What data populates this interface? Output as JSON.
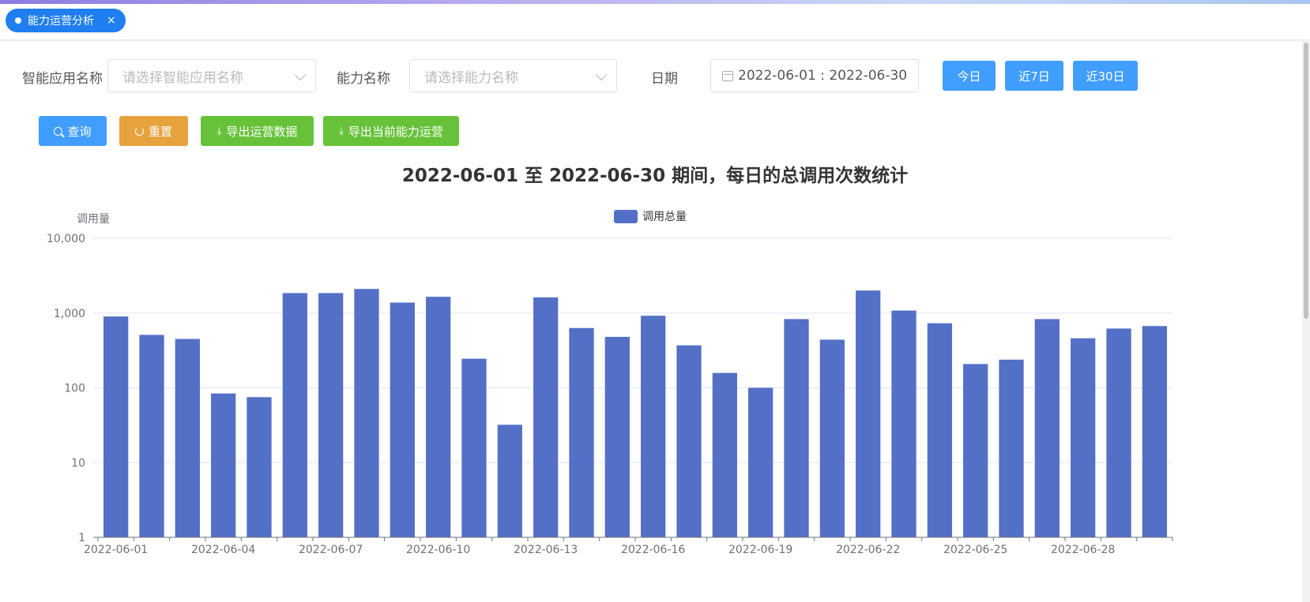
{
  "tab": {
    "label": "能力运营分析",
    "close": "×"
  },
  "filters": {
    "app_label": "智能应用名称",
    "app_placeholder": "请选择智能应用名称",
    "ability_label": "能力名称",
    "ability_placeholder": "请选择能力名称",
    "date_label": "日期",
    "date_value": "2022-06-01 : 2022-06-30"
  },
  "quick": {
    "today": "今日",
    "last7": "近7日",
    "last30": "近30日"
  },
  "actions": {
    "query": "查询",
    "reset": "重置",
    "export_ops": "导出运营数据",
    "export_current": "导出当前能力运营"
  },
  "chart_data": {
    "type": "bar",
    "title": "2022-06-01 至 2022-06-30 期间，每日的总调用次数统计",
    "ylabel": "调用量",
    "xlabel": "",
    "yscale": "log",
    "ylim": [
      1,
      10000
    ],
    "ytick_labels": [
      "1",
      "10",
      "100",
      "1,000",
      "10,000"
    ],
    "legend": "top-center",
    "grid": true,
    "bar_color": "#5470c6",
    "categories": [
      "2022-06-01",
      "2022-06-02",
      "2022-06-03",
      "2022-06-04",
      "2022-06-05",
      "2022-06-06",
      "2022-06-07",
      "2022-06-08",
      "2022-06-09",
      "2022-06-10",
      "2022-06-11",
      "2022-06-12",
      "2022-06-13",
      "2022-06-14",
      "2022-06-15",
      "2022-06-16",
      "2022-06-17",
      "2022-06-18",
      "2022-06-19",
      "2022-06-20",
      "2022-06-21",
      "2022-06-22",
      "2022-06-23",
      "2022-06-24",
      "2022-06-25",
      "2022-06-26",
      "2022-06-27",
      "2022-06-28",
      "2022-06-29",
      "2022-06-30"
    ],
    "xtick_labels": [
      "2022-06-01",
      "2022-06-04",
      "2022-06-07",
      "2022-06-10",
      "2022-06-13",
      "2022-06-16",
      "2022-06-19",
      "2022-06-22",
      "2022-06-25",
      "2022-06-28"
    ],
    "series": [
      {
        "name": "调用总量",
        "values": [
          900,
          510,
          450,
          84,
          75,
          1850,
          1850,
          2100,
          1380,
          1650,
          245,
          32,
          1620,
          630,
          480,
          920,
          370,
          158,
          100,
          830,
          440,
          2000,
          1080,
          730,
          208,
          238,
          830,
          460,
          620,
          670
        ]
      }
    ]
  }
}
